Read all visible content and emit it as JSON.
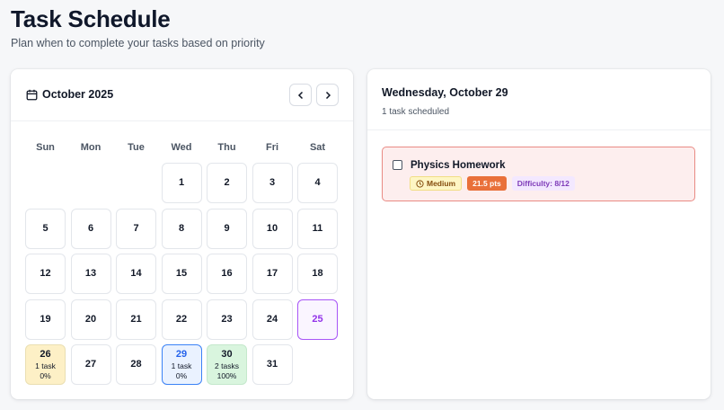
{
  "header": {
    "title": "Task Schedule",
    "subtitle": "Plan when to complete your tasks based on priority"
  },
  "calendar": {
    "month_label": "October 2025",
    "icon": "calendar-icon",
    "prev_icon": "chevron-left-icon",
    "next_icon": "chevron-right-icon",
    "weekdays": [
      "Sun",
      "Mon",
      "Tue",
      "Wed",
      "Thu",
      "Fri",
      "Sat"
    ],
    "leading_blanks": 3,
    "days": [
      {
        "num": "1"
      },
      {
        "num": "2"
      },
      {
        "num": "3"
      },
      {
        "num": "4"
      },
      {
        "num": "5"
      },
      {
        "num": "6"
      },
      {
        "num": "7"
      },
      {
        "num": "8"
      },
      {
        "num": "9"
      },
      {
        "num": "10"
      },
      {
        "num": "11"
      },
      {
        "num": "12"
      },
      {
        "num": "13"
      },
      {
        "num": "14"
      },
      {
        "num": "15"
      },
      {
        "num": "16"
      },
      {
        "num": "17"
      },
      {
        "num": "18"
      },
      {
        "num": "19"
      },
      {
        "num": "20"
      },
      {
        "num": "21"
      },
      {
        "num": "22"
      },
      {
        "num": "23"
      },
      {
        "num": "24"
      },
      {
        "num": "25",
        "state": "today"
      },
      {
        "num": "26",
        "tasks": "1 task",
        "progress": "0%",
        "state": "pending"
      },
      {
        "num": "27"
      },
      {
        "num": "28"
      },
      {
        "num": "29",
        "tasks": "1 task",
        "progress": "0%",
        "state": "selected"
      },
      {
        "num": "30",
        "tasks": "2 tasks",
        "progress": "100%",
        "state": "done"
      },
      {
        "num": "31"
      }
    ]
  },
  "day_panel": {
    "title": "Wednesday, October 29",
    "count": "1 task scheduled",
    "tasks": [
      {
        "title": "Physics Homework",
        "priority": "Medium",
        "priority_icon": "clock-icon",
        "points": "21.5 pts",
        "difficulty": "Difficulty: 8/12"
      }
    ]
  },
  "colors": {
    "today_accent": "#a855f7",
    "selected_accent": "#3b82f6",
    "pending_bg": "#fdf0c6",
    "done_bg": "#d9f5de",
    "task_border": "#e98a84",
    "points_badge": "#e9703a"
  }
}
